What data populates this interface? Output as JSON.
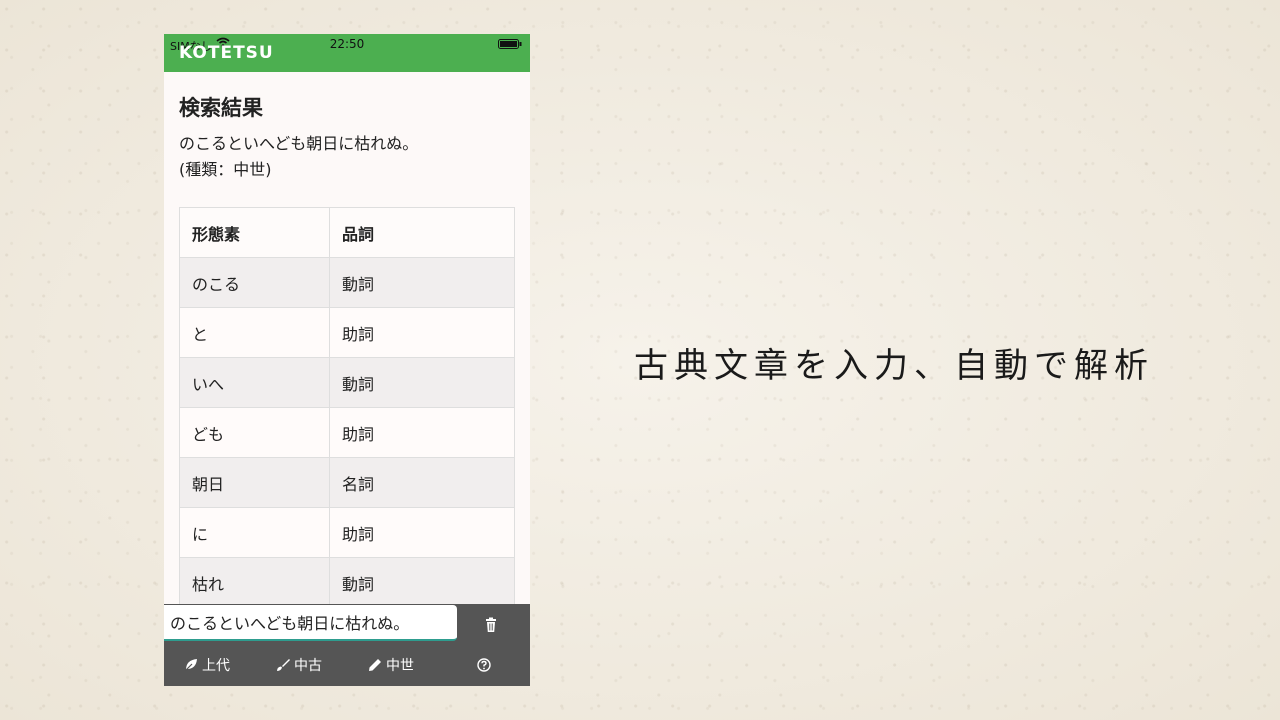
{
  "status": {
    "carrier": "SIMなし",
    "time": "22:50"
  },
  "app": {
    "brand": "KOTETSU"
  },
  "result": {
    "heading": "検索結果",
    "sentence": "のこるといへども朝日に枯れぬ。",
    "kind": "(種類：中世)"
  },
  "table": {
    "headers": [
      "形態素",
      "品詞"
    ],
    "rows": [
      [
        "のこる",
        "動詞"
      ],
      [
        "と",
        "助詞"
      ],
      [
        "いへ",
        "動詞"
      ],
      [
        "ども",
        "助詞"
      ],
      [
        "朝日",
        "名詞"
      ],
      [
        "に",
        "助詞"
      ],
      [
        "枯れ",
        "動詞"
      ]
    ]
  },
  "input": {
    "value": "のこるといへども朝日に枯れぬ。"
  },
  "nav": {
    "jodai": "上代",
    "chuko": "中古",
    "chusei": "中世"
  },
  "caption": "古典文章を入力、自動で解析",
  "colors": {
    "accent": "#4caf50",
    "bar": "#555555",
    "underline": "#2e9d8f"
  },
  "icons": [
    "wifi-icon",
    "battery-icon",
    "trash-icon",
    "leaf-icon",
    "brush-icon",
    "pencil-icon",
    "help-circle-icon"
  ]
}
